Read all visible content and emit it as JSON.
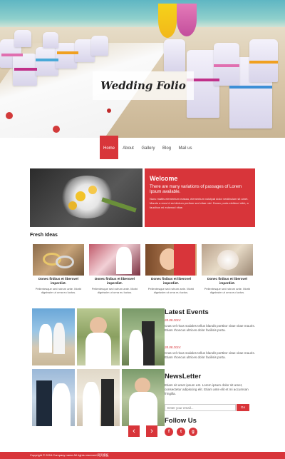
{
  "hero": {
    "title": "Wedding Folio"
  },
  "nav": {
    "items": [
      "Home",
      "About",
      "Gallery",
      "Blog",
      "Mail us"
    ],
    "active": "Home"
  },
  "welcome": {
    "heading": "Welcome",
    "lead": "There are many variations of passages of Lorem Ipsum available.",
    "body": "Nunc mattis elementum massa, elementum volutpat dolor vestibulum sit amet. Mauris a eros id est dictum pretium sed vitae nisl. Donec porta eleifend nibh, a faucibus mi euismod vitae."
  },
  "fresh_ideas": {
    "title": "Fresh Ideas",
    "items": [
      {
        "title": "Donec finibus et liberovel imperdiet.",
        "text": "Pellentesque sed rutrum ante. Morbi dignissim ut urna eu luctus."
      },
      {
        "title": "Donec finibus et liberovel imperdiet.",
        "text": "Pellentesque sed rutrum ante. Morbi dignissim ut urna eu luctus."
      },
      {
        "title": "Donec finibus et liberovel imperdiet.",
        "text": "Pellentesque sed rutrum ante. Morbi dignissim ut urna eu luctus."
      },
      {
        "title": "Donec finibus et liberovel imperdiet.",
        "text": "Pellentesque sed rutrum ante. Morbi dignissim ut urna eu luctus."
      }
    ]
  },
  "latest_events": {
    "title": "Latest Events",
    "items": [
      {
        "date": "28.08.2014",
        "text": "Cras vel risus sodales tellus blandit porttitor vitae vitae mauris. Etiam rhoncus ultrices dolor facilisis porta."
      },
      {
        "date": "28.08.2014",
        "text": "Cras vel risus sodales tellus blandit porttitor vitae vitae mauris. Etiam rhoncus ultrices dolor facilisis porta."
      }
    ]
  },
  "newsletter": {
    "title": "NewsLetter",
    "text": "Etiam sit amet ipsum est. Lorem ipsum dolor sit amet, consectetur adipiscing elit. Etiam ante elit et mi accumsan fringilla.",
    "placeholder": "Enter your email...",
    "button": "Go"
  },
  "follow": {
    "title": "Follow Us",
    "icons": [
      "f",
      "t",
      "g"
    ]
  },
  "footer": {
    "text": "Copyright © 2016.Company name All rights reserved.网页模板"
  },
  "colors": {
    "accent": "#d8353a"
  }
}
